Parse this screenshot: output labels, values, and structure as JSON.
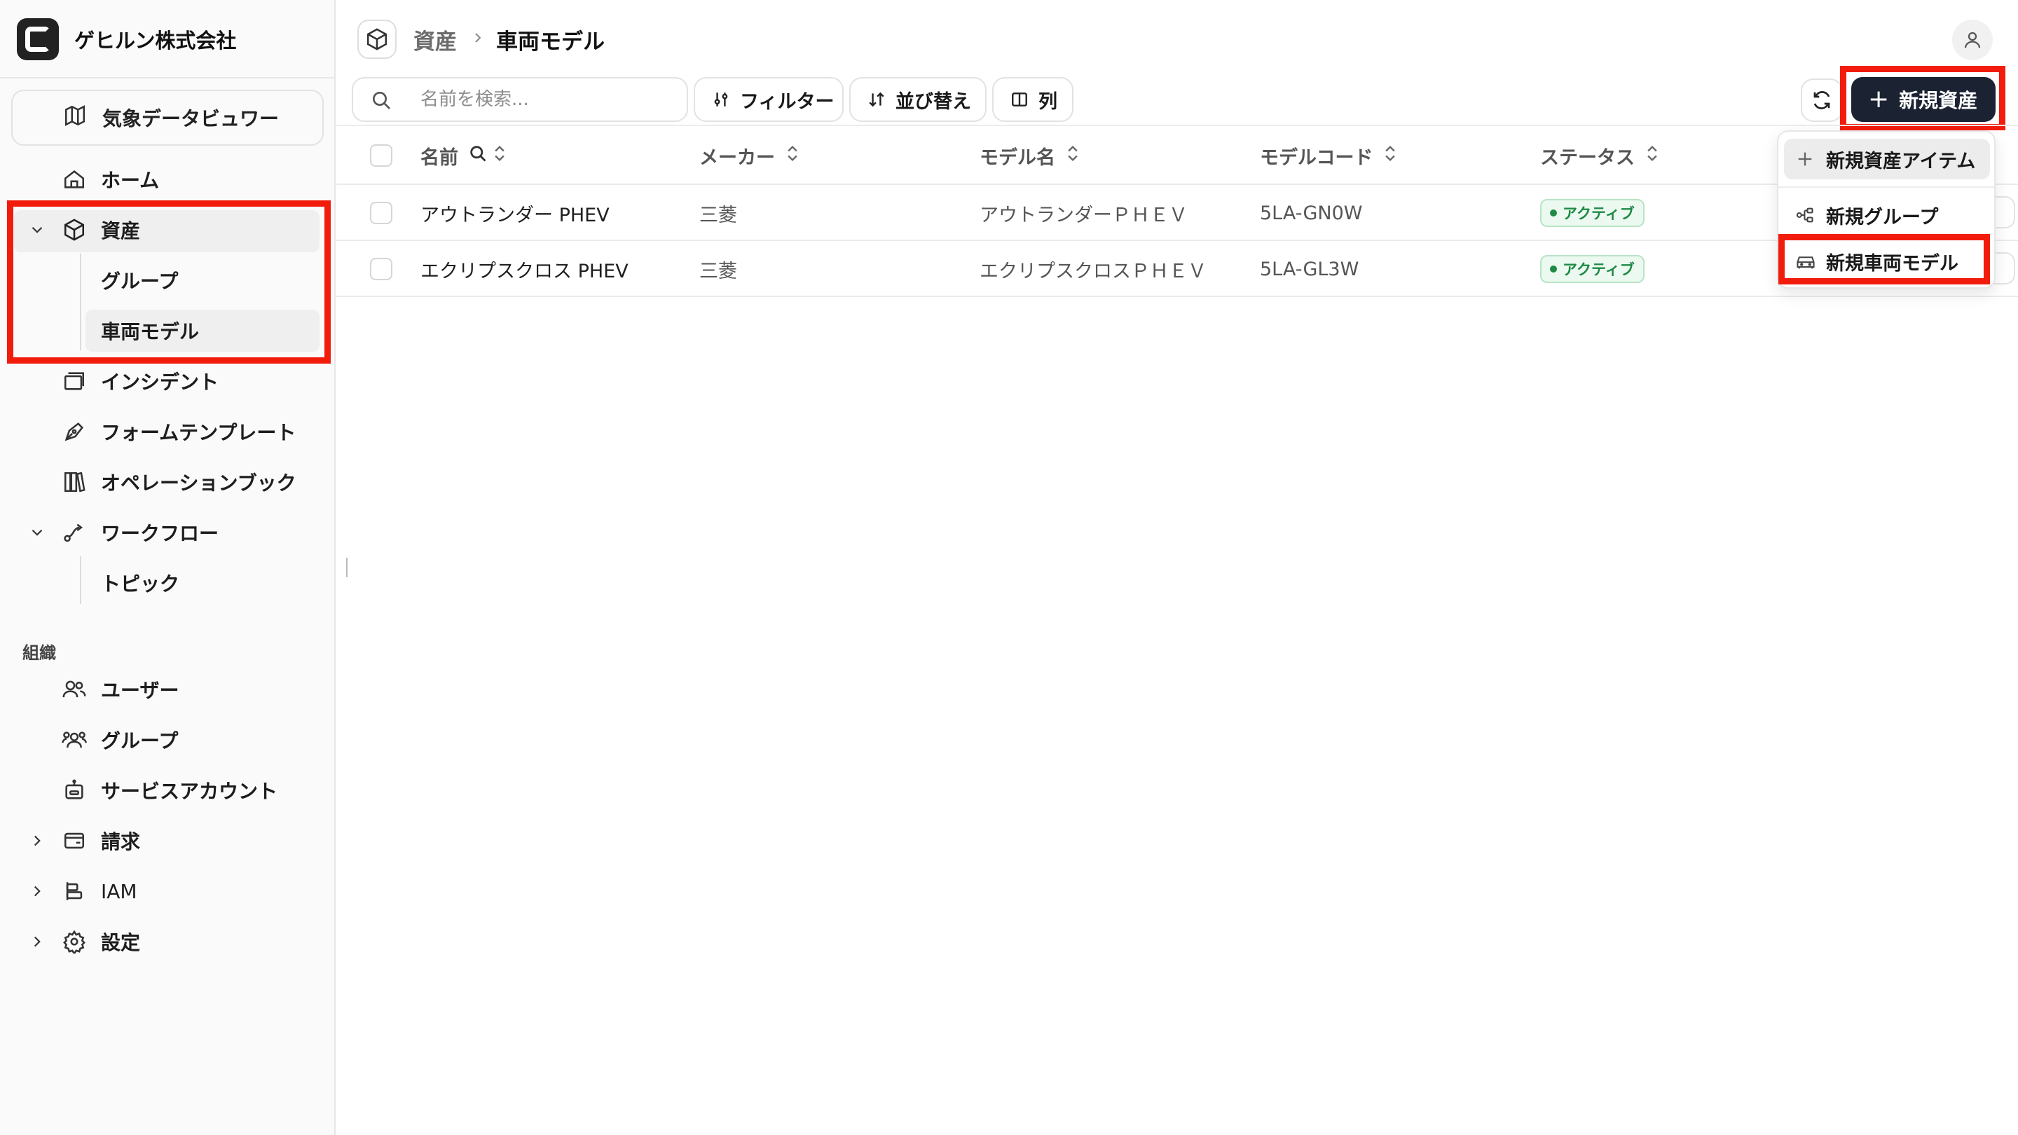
{
  "app": {
    "org_name": "ゲヒルン株式会社"
  },
  "sidebar": {
    "viewer_label": "気象データビュワー",
    "items": [
      {
        "label": "ホーム"
      },
      {
        "label": "資産"
      },
      {
        "label": "グループ"
      },
      {
        "label": "車両モデル"
      },
      {
        "label": "インシデント"
      },
      {
        "label": "フォームテンプレート"
      },
      {
        "label": "オペレーションブック"
      },
      {
        "label": "ワークフロー"
      },
      {
        "label": "トピック"
      }
    ],
    "section_org": "組織",
    "org_items": [
      {
        "label": "ユーザー"
      },
      {
        "label": "グループ"
      },
      {
        "label": "サービスアカウント"
      },
      {
        "label": "請求"
      },
      {
        "label": "IAM"
      },
      {
        "label": "設定"
      }
    ]
  },
  "breadcrumb": {
    "parent": "資産",
    "current": "車両モデル"
  },
  "toolbar": {
    "search_placeholder": "名前を検索...",
    "filter_label": "フィルター",
    "sort_label": "並び替え",
    "columns_label": "列",
    "new_asset_label": "新規資産"
  },
  "table": {
    "headers": [
      "名前",
      "メーカー",
      "モデル名",
      "モデルコード",
      "ステータス"
    ],
    "rows": [
      {
        "name": "アウトランダー PHEV",
        "maker": "三菱",
        "model_name": "アウトランダーＰＨＥＶ",
        "model_code": "5LA-GN0W",
        "status": "アクティブ"
      },
      {
        "name": "エクリプスクロス PHEV",
        "maker": "三菱",
        "model_name": "エクリプスクロスＰＨＥＶ",
        "model_code": "5LA-GL3W",
        "status": "アクティブ"
      }
    ]
  },
  "dropdown": {
    "items": [
      {
        "label": "新規資産アイテム"
      },
      {
        "label": "新規グループ"
      },
      {
        "label": "新規車両モデル"
      }
    ]
  },
  "colors": {
    "highlight": "#f21c0c",
    "primary": "#1b2333",
    "status_active": "#1e8a44"
  }
}
